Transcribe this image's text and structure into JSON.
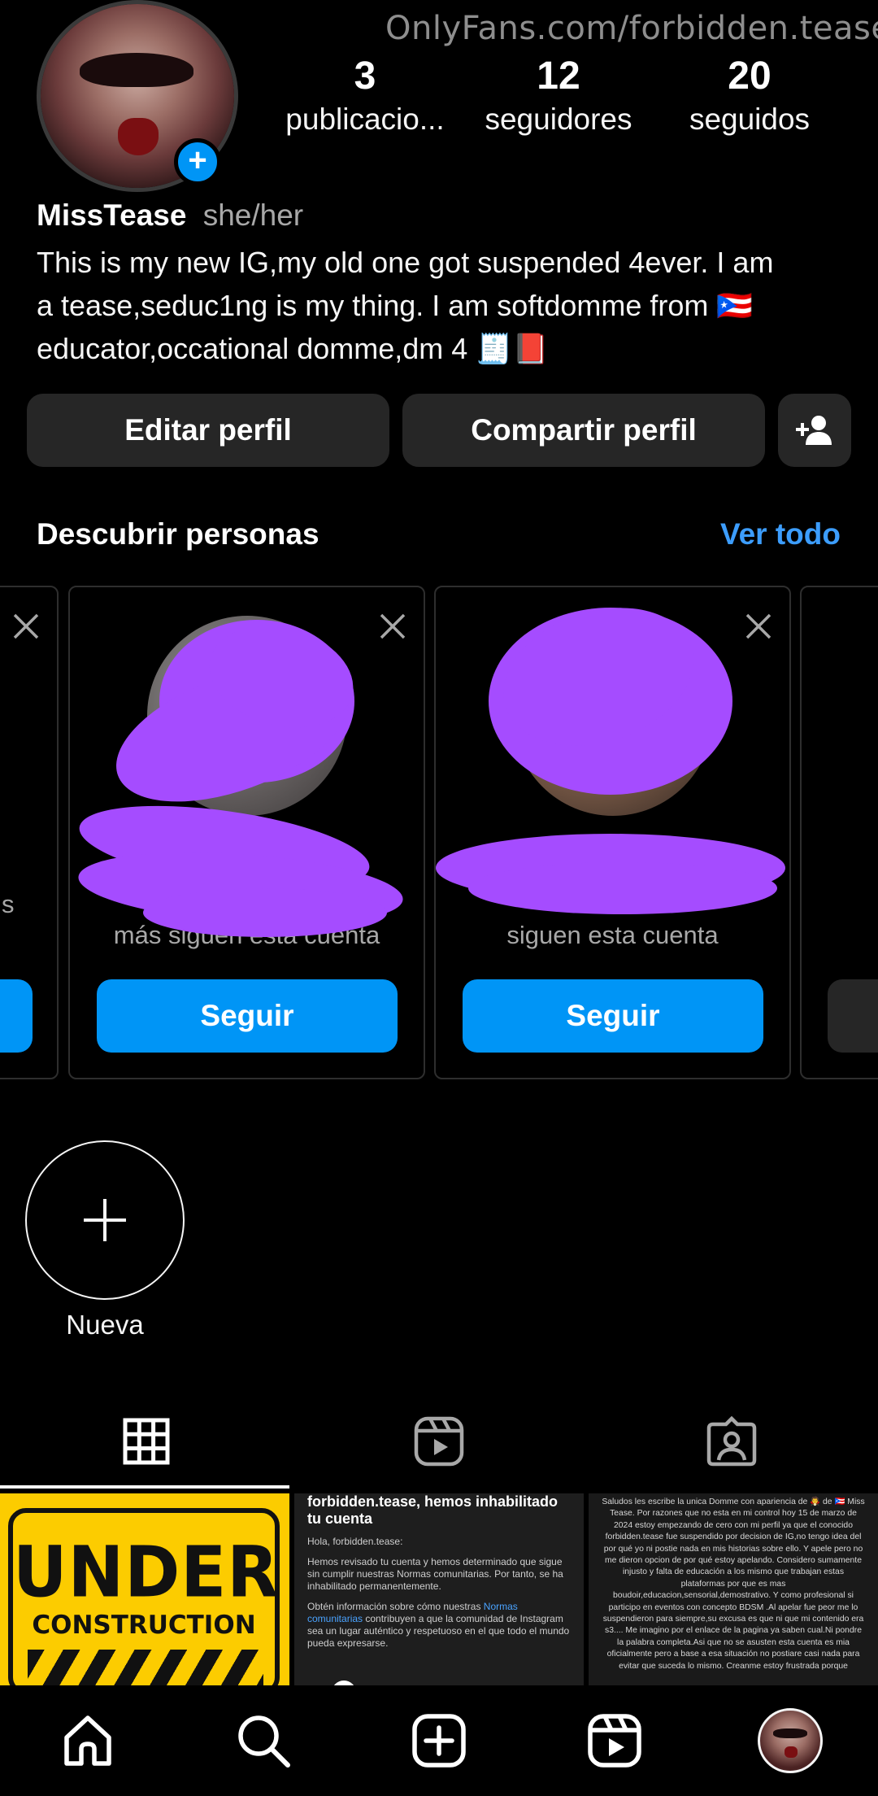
{
  "watermark": "OnlyFans.com/forbidden.tease",
  "profile": {
    "name": "MissTease",
    "pronouns": "she/her",
    "bio_lines": [
      "This is my new IG,my old one got suspended 4ever. I am",
      "a tease,seduc1ng is my thing. I am softdomme from 🇵🇷",
      "educator,occational domme,dm 4 🧾📕"
    ],
    "avatar_icon": "profile-photo",
    "add_story_icon": "plus-icon"
  },
  "stats": [
    {
      "value": "3",
      "label": "publicacio..."
    },
    {
      "value": "12",
      "label": "seguidores"
    },
    {
      "value": "20",
      "label": "seguidos"
    }
  ],
  "actions": {
    "edit": "Editar perfil",
    "share": "Compartir perfil",
    "add_person_icon": "person-add-icon"
  },
  "discover": {
    "title": "Descubrir personas",
    "see_all": "Ver todo",
    "left_edge_text": "s",
    "cards": [
      {
        "subtitle": "más siguen esta cuenta",
        "button": "Seguir"
      },
      {
        "subtitle": "siguen esta cuenta",
        "button": "Seguir"
      }
    ]
  },
  "highlights": {
    "new_label": "Nueva"
  },
  "tabs": [
    {
      "icon": "grid-icon",
      "active": true
    },
    {
      "icon": "reels-icon",
      "active": false
    },
    {
      "icon": "tagged-icon",
      "active": false
    }
  ],
  "posts": {
    "p1": {
      "line1": "UNDER",
      "line2": "CONSTRUCTION"
    },
    "p2": {
      "heading": "forbidden.tease, hemos inhabilitado tu cuenta",
      "greeting": "Hola, forbidden.tease:",
      "para1": "Hemos revisado tu cuenta y hemos determinado que sigue sin cumplir nuestras Normas comunitarias. Por tanto, se ha inhabilitado permanentemente.",
      "para2_start": "Obtén información sobre cómo nuestras ",
      "para2_link": "Normas comunitarias",
      "para2_end": " contribuyen a que la comunidad de Instagram sea un lugar auténtico y respetuoso en el que todo el mundo pueda expresarse."
    },
    "p3": {
      "text": "Saludos les escribe la unica Domme con apariencia de 🧛 de 🇵🇷 Miss Tease. Por razones que no esta en mi control hoy 15 de marzo de 2024 estoy empezando de cero con mi perfil ya que el conocido forbidden.tease fue suspendido por decision de IG,no tengo idea del por qué yo ni postie nada en mis historias sobre ello. Y apele pero no me dieron opcion de por qué estoy apelando. Considero sumamente injusto y falta de educación a los mismo que trabajan estas plataformas por que es mas boudoir,educacion,sensorial,demostrativo. Y como profesional si participo en eventos con concepto BDSM .Al apelar fue peor me lo suspendieron para siempre,su excusa es que ni que mi contenido era s3.... Me imagino por el enlace de la pagina ya saben cual.Ni pondre la palabra completa.Asi que no se asusten esta cuenta es mia oficialmente pero a base a esa situación no postiare casi nada para evitar que suceda lo mismo. Creanme estoy frustrada porque"
    }
  },
  "bottom_nav": [
    {
      "icon": "home-icon"
    },
    {
      "icon": "search-icon"
    },
    {
      "icon": "create-icon"
    },
    {
      "icon": "reels-icon"
    },
    {
      "icon": "profile-avatar-icon"
    }
  ],
  "colors": {
    "accent": "#0095f6",
    "link": "#3c9dfd",
    "button_bg": "#262626",
    "scribble": "#a54cff"
  }
}
